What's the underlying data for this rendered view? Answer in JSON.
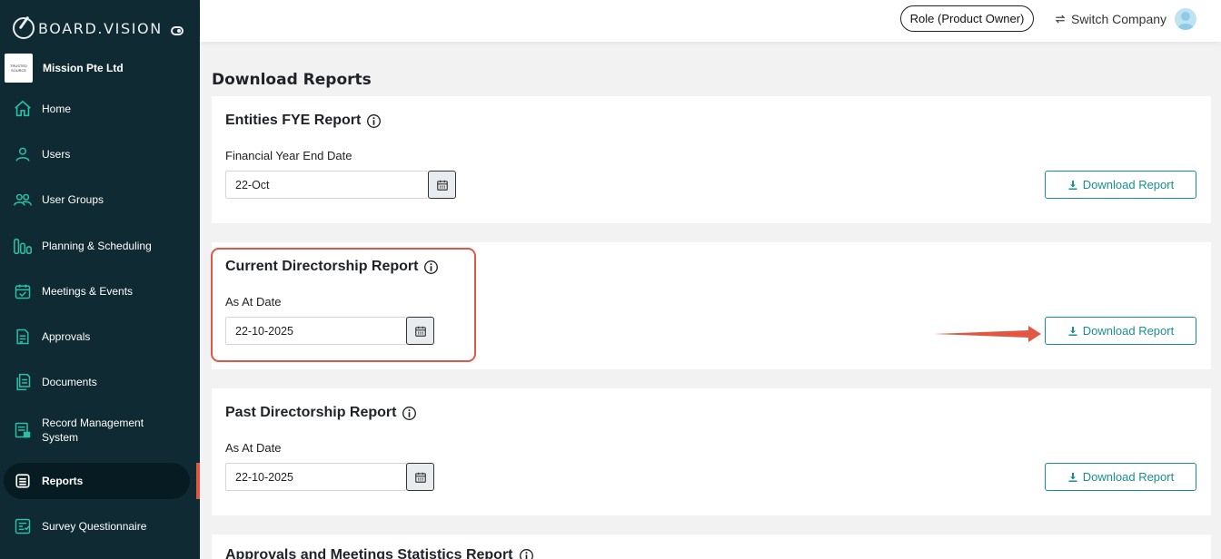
{
  "brand": {
    "name": "BOARD.VISION"
  },
  "company": {
    "name": "Mission Pte Ltd",
    "logo_text": "TRUSTED SOURCE"
  },
  "sidebar": {
    "items": [
      {
        "label": "Home",
        "icon": "home-icon"
      },
      {
        "label": "Users",
        "icon": "user-icon"
      },
      {
        "label": "User Groups",
        "icon": "user-group-icon"
      },
      {
        "label": "Planning & Scheduling",
        "icon": "planning-icon"
      },
      {
        "label": "Meetings & Events",
        "icon": "calendar-check-icon"
      },
      {
        "label": "Approvals",
        "icon": "approval-icon"
      },
      {
        "label": "Documents",
        "icon": "documents-icon"
      },
      {
        "label": "Record Management System",
        "icon": "record-icon"
      },
      {
        "label": "Reports",
        "icon": "reports-icon",
        "active": true
      },
      {
        "label": "Survey Questionnaire",
        "icon": "survey-icon"
      }
    ]
  },
  "header": {
    "role_label": "Role (Product Owner)",
    "switch_label": "Switch Company"
  },
  "main": {
    "title": "Download Reports",
    "download_label": "Download Report",
    "reports": [
      {
        "title": "Entities FYE Report",
        "field_label": "Financial Year End Date",
        "value": "22-Oct"
      },
      {
        "title": "Current Directorship Report",
        "field_label": "As At Date",
        "value": "22-10-2025"
      },
      {
        "title": "Past Directorship Report",
        "field_label": "As At Date",
        "value": "22-10-2025"
      },
      {
        "title": "Approvals and Meetings Statistics Report"
      }
    ]
  },
  "colors": {
    "sidebar_bg": "#0f2a33",
    "accent": "#1a8f8f",
    "highlight": "#e05745",
    "nav_icon": "#2bbfa4"
  }
}
